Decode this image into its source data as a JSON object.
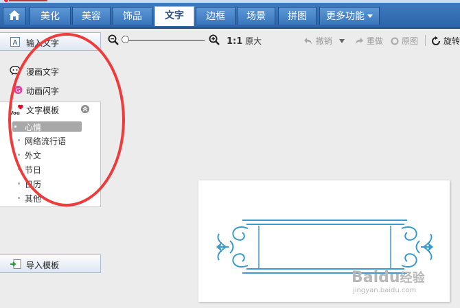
{
  "tabs": [
    {
      "id": "home",
      "label": "",
      "icon": "home-icon"
    },
    {
      "id": "beautify",
      "label": "美化"
    },
    {
      "id": "makeup",
      "label": "美容"
    },
    {
      "id": "accessories",
      "label": "饰品"
    },
    {
      "id": "text",
      "label": "文字",
      "active": true
    },
    {
      "id": "border",
      "label": "边框"
    },
    {
      "id": "scene",
      "label": "场景"
    },
    {
      "id": "collage",
      "label": "拼图"
    },
    {
      "id": "more",
      "label": "更多功能"
    }
  ],
  "toolbar": {
    "ratio": "1:1",
    "actual_size": "原大",
    "undo": "撤销",
    "redo": "重做",
    "original": "原图",
    "rotate": "旋转"
  },
  "left_panel": {
    "input_text": "输入文字",
    "comic_text": "漫画文字",
    "animated_text": "动画闪字",
    "template_title": "文字模板",
    "template_items": [
      "心情",
      "网络流行语",
      "外文",
      "节日",
      "日历",
      "其他"
    ],
    "selected_index": 0,
    "import_template": "导入模板"
  },
  "watermark": {
    "brand": "Baidu",
    "brand_suffix": "经验",
    "url": "jingyan.baidu.com"
  },
  "colors": {
    "accent_red": "#ef3b3b",
    "tab_blue": "#3a76bd",
    "frame_blue": "#3a9bd0"
  }
}
